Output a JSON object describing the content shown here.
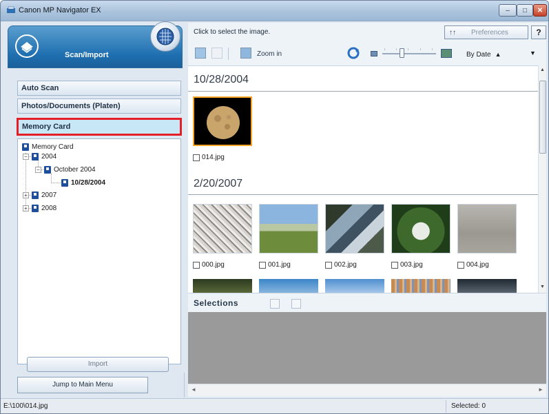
{
  "window": {
    "title": "Canon MP Navigator EX",
    "controls": {
      "minimize": "–",
      "maximize": "□",
      "close": "✕"
    }
  },
  "left": {
    "section_title": "Scan/Import",
    "modes": [
      {
        "label": "Auto Scan",
        "selected": false
      },
      {
        "label": "Photos/Documents (Platen)",
        "selected": false
      },
      {
        "label": "Memory Card",
        "selected": true
      }
    ],
    "tree": {
      "root": "Memory Card",
      "y2004": "2004",
      "october": "October 2004",
      "date": "10/28/2004",
      "y2007": "2007",
      "y2008": "2008"
    },
    "import_label": "Import",
    "jump_label": "Jump to Main Menu"
  },
  "right": {
    "hint": "Click to select the image.",
    "preferences_label": "Preferences",
    "help_label": "?",
    "zoom_label": "Zoom in",
    "sort_label": "By Date",
    "groups": [
      {
        "date": "10/28/2004",
        "items": [
          {
            "name": "014.jpg",
            "kind": "moon",
            "checked": false,
            "highlighted": true
          }
        ]
      },
      {
        "date": "2/20/2007",
        "items": [
          {
            "name": "000.jpg",
            "kind": "blossom",
            "checked": false
          },
          {
            "name": "001.jpg",
            "kind": "grass",
            "checked": false
          },
          {
            "name": "002.jpg",
            "kind": "stream",
            "checked": false
          },
          {
            "name": "003.jpg",
            "kind": "flower",
            "checked": false
          },
          {
            "name": "004.jpg",
            "kind": "sand",
            "checked": false
          }
        ]
      }
    ],
    "selections_label": "Selections"
  },
  "statusbar": {
    "path": "E:\\100\\014.jpg",
    "selected": "Selected: 0"
  },
  "colors": {
    "accent_blue": "#1f6fb0",
    "highlight_red": "#e41e26",
    "thumb_selected": "#f6a623"
  }
}
